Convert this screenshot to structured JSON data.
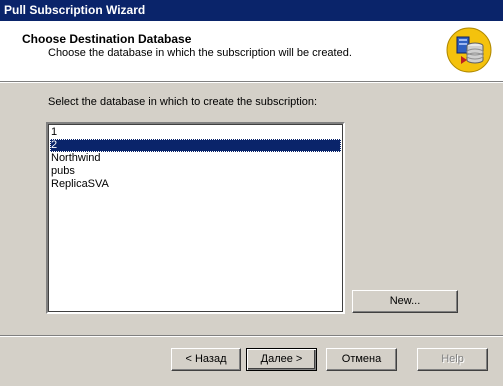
{
  "window": {
    "title": "Pull Subscription Wizard"
  },
  "header": {
    "title": "Choose Destination Database",
    "subtitle": "Choose the database in which the subscription will be created.",
    "icon": "database-wizard-icon"
  },
  "main": {
    "prompt": "Select the database in which to create the subscription:",
    "databases": [
      {
        "label": "1",
        "selected": false
      },
      {
        "label": "2",
        "selected": true
      },
      {
        "label": "Northwind",
        "selected": false
      },
      {
        "label": "pubs",
        "selected": false
      },
      {
        "label": "ReplicaSVA",
        "selected": false
      }
    ],
    "new_button": "New..."
  },
  "footer": {
    "back_label": "< Назад",
    "next_label": "Далее >",
    "cancel_label": "Отмена",
    "help_label": "Help"
  },
  "colors": {
    "titlebar": "#0a246a",
    "selection": "#0a246a",
    "dialog_bg": "#d4d0c8"
  }
}
